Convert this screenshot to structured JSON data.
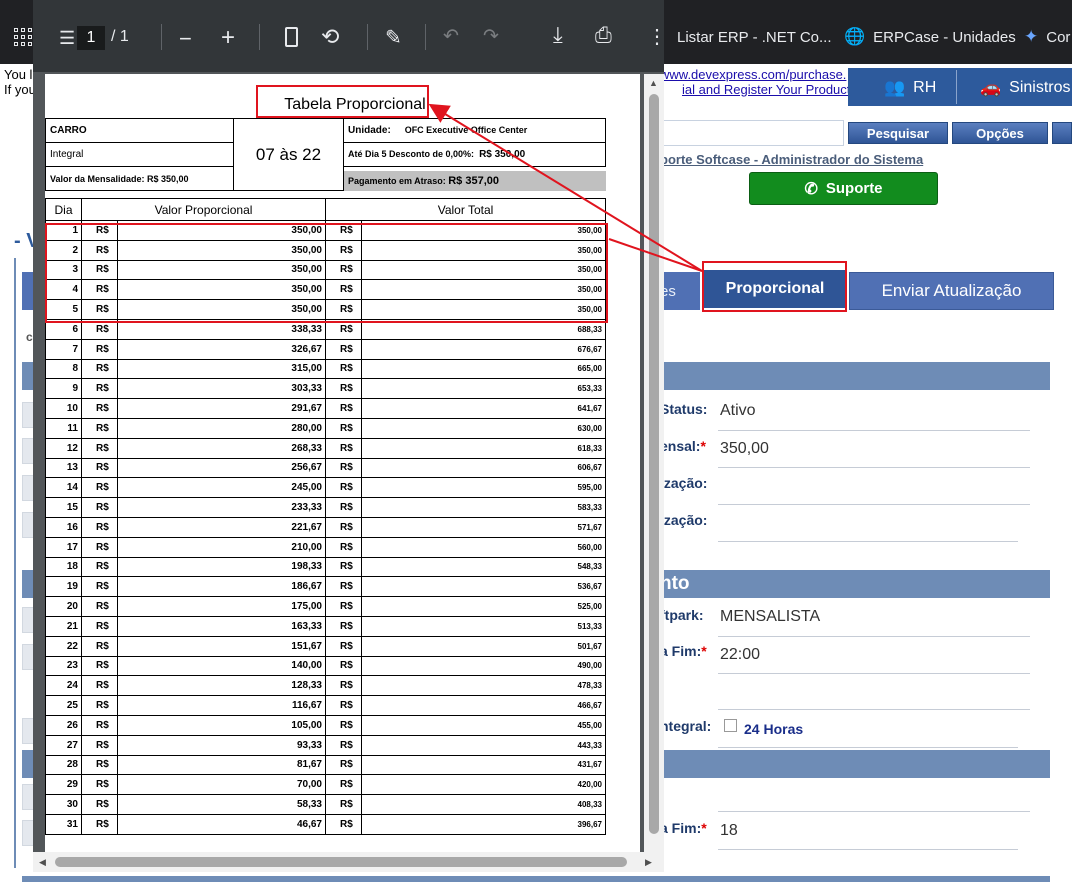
{
  "browser": {
    "bookmarks": [
      {
        "label": "Listar ERP - .NET Co...",
        "icon": "bookmark-page-icon"
      },
      {
        "label": "ERPCase - Unidades",
        "icon": "globe-icon"
      },
      {
        "label": "Cor",
        "icon": "bookmark-app-icon"
      }
    ]
  },
  "background": {
    "notice_line1": "You l",
    "notice_line2": "If you",
    "devexpress_link1": "www.devexpress.com/purchase.",
    "devexpress_link2": "ial and Register Your Product.",
    "nav": [
      {
        "label": "RH",
        "icon": "people-icon"
      },
      {
        "label": "Sinistros",
        "icon": "car-crash-icon"
      }
    ],
    "buttons": {
      "search": "Pesquisar",
      "options": "Opções"
    },
    "admin_link": "porte Softcase - Administrador do Sistema",
    "support_button": "Suporte",
    "page_dash": "- V",
    "tabs": {
      "partial": "es",
      "proporcional": "Proporcional",
      "enviar": "Enviar Atualização"
    },
    "section2_header": "nto",
    "fields": [
      {
        "label": "Status:",
        "required": false,
        "value": "Ativo"
      },
      {
        "label": "ensal:",
        "required": true,
        "value": "350,00"
      },
      {
        "label": "ização:",
        "required": false,
        "value": ""
      },
      {
        "label": "ização:",
        "required": false,
        "value": ""
      },
      {
        "label": "ftpark:",
        "required": false,
        "value": "MENSALISTA"
      },
      {
        "label": "a Fim:",
        "required": true,
        "value": "22:00"
      },
      {
        "label": "ntegral:",
        "required": false,
        "value": ""
      },
      {
        "label": "a Fim:",
        "required": true,
        "value": "18"
      }
    ],
    "checkbox_24h_label": "24 Horas"
  },
  "pdf_viewer": {
    "current_page": "1",
    "page_total": "/  1",
    "document": {
      "title": "Tabela Proporcional",
      "vehicle": "CARRO",
      "plan": "Integral",
      "schedule": "07 às 22",
      "unidade_label": "Unidade:",
      "unidade_value": "OFC Executive Office Center",
      "discount_label": "Até Dia 5 Desconto de 0,00%:",
      "discount_value": "R$ 350,00",
      "mensalidade": "Valor da Mensalidade: R$ 350,00",
      "atraso_label": "Pagamento em Atraso:",
      "atraso_value": "R$ 357,00",
      "columns": {
        "dia": "Dia",
        "proporcional": "Valor Proporcional",
        "total": "Valor Total"
      },
      "currency": "R$",
      "rows": [
        {
          "dia": "1",
          "prop": "350,00",
          "total": "350,00"
        },
        {
          "dia": "2",
          "prop": "350,00",
          "total": "350,00"
        },
        {
          "dia": "3",
          "prop": "350,00",
          "total": "350,00"
        },
        {
          "dia": "4",
          "prop": "350,00",
          "total": "350,00"
        },
        {
          "dia": "5",
          "prop": "350,00",
          "total": "350,00"
        },
        {
          "dia": "6",
          "prop": "338,33",
          "total": "688,33"
        },
        {
          "dia": "7",
          "prop": "326,67",
          "total": "676,67"
        },
        {
          "dia": "8",
          "prop": "315,00",
          "total": "665,00"
        },
        {
          "dia": "9",
          "prop": "303,33",
          "total": "653,33"
        },
        {
          "dia": "10",
          "prop": "291,67",
          "total": "641,67"
        },
        {
          "dia": "11",
          "prop": "280,00",
          "total": "630,00"
        },
        {
          "dia": "12",
          "prop": "268,33",
          "total": "618,33"
        },
        {
          "dia": "13",
          "prop": "256,67",
          "total": "606,67"
        },
        {
          "dia": "14",
          "prop": "245,00",
          "total": "595,00"
        },
        {
          "dia": "15",
          "prop": "233,33",
          "total": "583,33"
        },
        {
          "dia": "16",
          "prop": "221,67",
          "total": "571,67"
        },
        {
          "dia": "17",
          "prop": "210,00",
          "total": "560,00"
        },
        {
          "dia": "18",
          "prop": "198,33",
          "total": "548,33"
        },
        {
          "dia": "19",
          "prop": "186,67",
          "total": "536,67"
        },
        {
          "dia": "20",
          "prop": "175,00",
          "total": "525,00"
        },
        {
          "dia": "21",
          "prop": "163,33",
          "total": "513,33"
        },
        {
          "dia": "22",
          "prop": "151,67",
          "total": "501,67"
        },
        {
          "dia": "23",
          "prop": "140,00",
          "total": "490,00"
        },
        {
          "dia": "24",
          "prop": "128,33",
          "total": "478,33"
        },
        {
          "dia": "25",
          "prop": "116,67",
          "total": "466,67"
        },
        {
          "dia": "26",
          "prop": "105,00",
          "total": "455,00"
        },
        {
          "dia": "27",
          "prop": "93,33",
          "total": "443,33"
        },
        {
          "dia": "28",
          "prop": "81,67",
          "total": "431,67"
        },
        {
          "dia": "29",
          "prop": "70,00",
          "total": "420,00"
        },
        {
          "dia": "30",
          "prop": "58,33",
          "total": "408,33"
        },
        {
          "dia": "31",
          "prop": "46,67",
          "total": "396,67"
        }
      ]
    }
  },
  "colors": {
    "annotation": "#e0141e",
    "accent": "#2f5596",
    "support": "#128c1e"
  }
}
